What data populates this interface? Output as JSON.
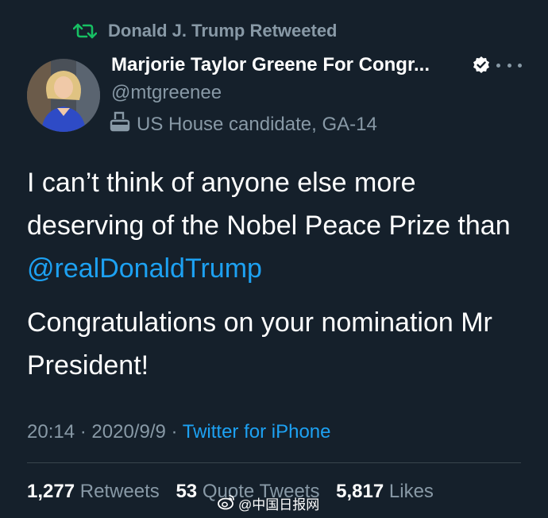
{
  "retweet_header": {
    "label": "Donald J. Trump Retweeted",
    "icon": "retweet-icon",
    "icon_color": "#17bf63"
  },
  "author": {
    "name": "Marjorie Taylor Greene For Congr...",
    "handle": "@mtgreenee",
    "verified_icon": "verified-badge-icon",
    "more_icon": "more-options-icon",
    "avatar": "avatar"
  },
  "bio": {
    "icon": "ballot-box-icon",
    "text": "US House candidate, GA-14"
  },
  "tweet": {
    "line1": "I can’t think of anyone else more deserving of the Nobel Peace Prize than ",
    "mention": "@realDonaldTrump",
    "line2": "Congratulations on your nomination Mr President!"
  },
  "meta": {
    "time": "20:14",
    "separator": "·",
    "date": "2020/9/9",
    "source": "Twitter for iPhone"
  },
  "stats": {
    "retweets_count": "1,277",
    "retweets_label": "Retweets",
    "quotes_count": "53",
    "quotes_label": "Quote Tweets",
    "likes_count": "5,817",
    "likes_label": "Likes"
  },
  "watermark": {
    "text": "@中国日报网",
    "icon": "weibo-icon"
  },
  "colors": {
    "background": "#15202b",
    "text_primary": "#ffffff",
    "text_secondary": "#8899a6",
    "link": "#1da1f2",
    "divider": "#38444d"
  }
}
